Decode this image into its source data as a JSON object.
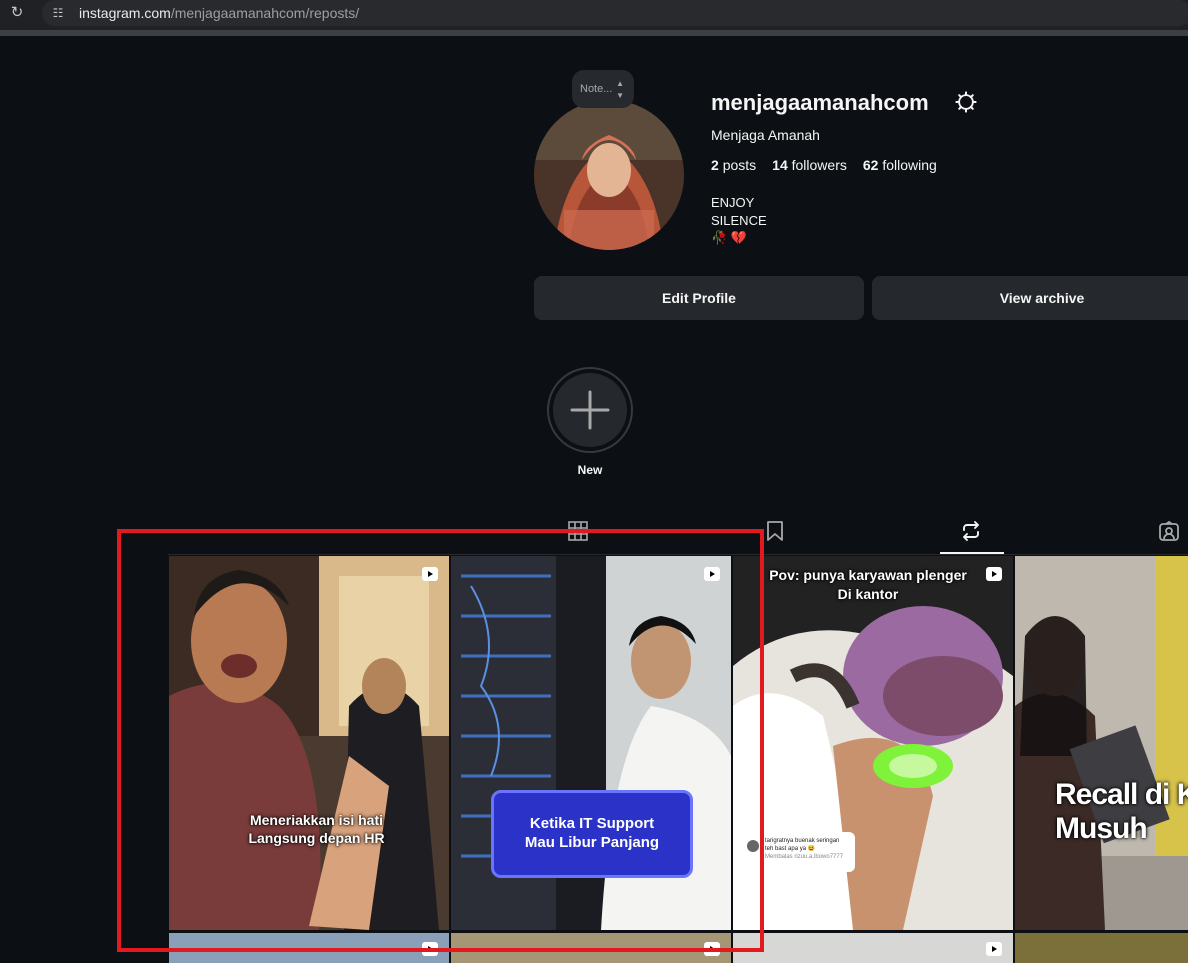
{
  "browser": {
    "url_host": "instagram.com",
    "url_path": "/menjagaamanahcom/reposts/"
  },
  "profile": {
    "note": "Note...",
    "username": "menjagaamanahcom",
    "full_name": "Menjaga Amanah",
    "posts_count": "2",
    "posts_label": "posts",
    "followers_count": "14",
    "followers_label": "followers",
    "following_count": "62",
    "following_label": "following",
    "bio_line1": "ENJOY",
    "bio_line2": "SILENCE",
    "bio_emoji": "🥀 💔"
  },
  "actions": {
    "edit_profile": "Edit Profile",
    "view_archive": "View archive"
  },
  "highlights": {
    "new_label": "New"
  },
  "tabs": [
    {
      "name": "posts",
      "icon": "grid-icon",
      "active": false
    },
    {
      "name": "saved",
      "icon": "bookmark-icon",
      "active": false
    },
    {
      "name": "reposts",
      "icon": "repost-icon",
      "active": true
    },
    {
      "name": "tagged",
      "icon": "tagged-icon",
      "active": false
    }
  ],
  "grid": [
    {
      "caption": "Meneriakkan isi hati\nLangsung depan HR",
      "type": "reel"
    },
    {
      "caption": "Ketika IT Support\nMau Libur Panjang",
      "type": "reel"
    },
    {
      "caption": "Pov: punya karyawan plenger\nDi kantor",
      "type": "reel"
    },
    {
      "caption": "Recall di K\nMusuh",
      "type": "reel"
    }
  ],
  "comment_card": {
    "text": "tarigratnya buenak seringan teh bast apa ya 😆",
    "reply": "Membalas rizuu.a.lbowo7777"
  },
  "colors": {
    "background": "#0c1014",
    "button": "#25292e",
    "annotation_red": "#e2191e"
  }
}
